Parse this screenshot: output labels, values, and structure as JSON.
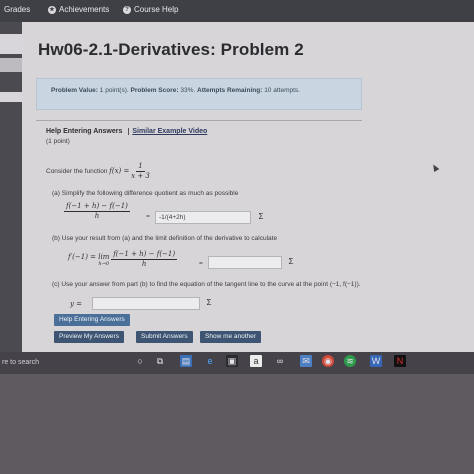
{
  "topbar": {
    "grades": "Grades",
    "achievements": "Achievements",
    "course_help": "Course Help"
  },
  "page": {
    "title": "Hw06-2.1-Derivatives: Problem 2"
  },
  "info": {
    "problem_value_label": "Problem Value:",
    "problem_value": "1 point(s).",
    "problem_score_label": "Problem Score:",
    "problem_score": "33%.",
    "attempts_label": "Attempts Remaining:",
    "attempts": "10 attempts."
  },
  "help": {
    "heading": "Help Entering Answers",
    "example_link": "Similar Example Video",
    "points": "(1 point)"
  },
  "problem": {
    "intro": "Consider the function",
    "func_lhs": "f(x) =",
    "func_num": "1",
    "func_den": "x + 3",
    "part_a": "(a)  Simplify the following difference quotient as much as possible",
    "part_a_num": "f(−1 + h) − f(−1)",
    "part_a_den": "h",
    "part_a_answer": "-1/(4+2h)",
    "part_b": "(b)  Use your result from (a) and the limit definition of the derivative to calculate",
    "part_b_lhs": "f′(−1) = lim",
    "part_b_sub": "h→0",
    "part_b_num": "f(−1 + h) − f(−1)",
    "part_b_den": "h",
    "part_b_answer": "",
    "part_c": "(c)  Use your answer from part (b) to find the equation of the tangent line to the curve at the point (−1, f(−1)).",
    "part_c_lhs": "y =",
    "part_c_answer": "",
    "equals": "=",
    "sigma": "Σ"
  },
  "buttons": {
    "help_entering": "Help Entering Answers",
    "preview": "Preview My Answers",
    "submit": "Submit Answers",
    "show_me": "Show me another"
  },
  "taskbar": {
    "search": "re to search",
    "icons": [
      "cortana-icon",
      "task-view-icon",
      "edge-icon",
      "store-icon",
      "amazon-icon",
      "chrome-icon",
      "spotify-icon",
      "netflix-icon"
    ]
  }
}
